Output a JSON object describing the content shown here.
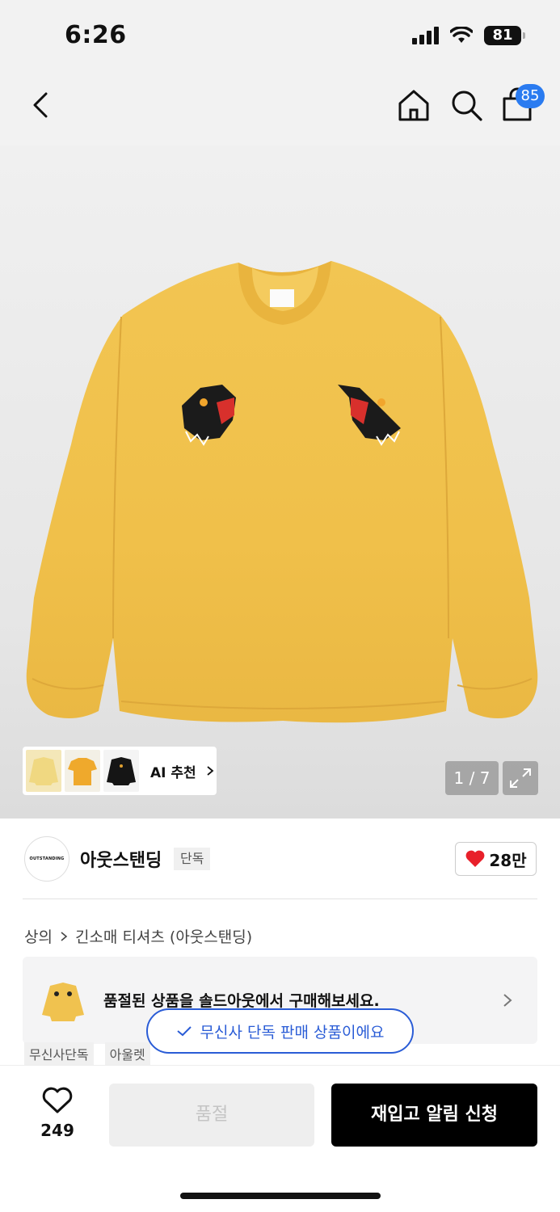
{
  "status_bar": {
    "time": "6:26",
    "battery": "81"
  },
  "nav": {
    "cart_badge": "85"
  },
  "gallery": {
    "ai_label": "AI 추천",
    "counter": "1 / 7",
    "thumbnails": [
      "yellow-sweatshirt",
      "yellow-tshirt",
      "black-sweatshirt"
    ]
  },
  "brand": {
    "logo_text": "OUTSTANDING",
    "name": "아웃스탠딩",
    "exclusive_tag": "단독",
    "like_count": "28만"
  },
  "breadcrumb": {
    "category": "상의",
    "subcategory": "긴소매 티셔츠 (아웃스탠딩)"
  },
  "soldout_banner": {
    "text": "품절된 상품을 솔드아웃에서 구매해보세요."
  },
  "tags": [
    "무신사단독",
    "아울렛"
  ],
  "toast": {
    "text": "무신사 단독 판매 상품이에요"
  },
  "bottom": {
    "wish_count": "249",
    "soldout_label": "품절",
    "restock_label": "재입고 알림 신청"
  },
  "colors": {
    "accent_blue": "#2a5cd6",
    "badge_blue": "#2a7bf0",
    "heart_red": "#e8202a",
    "product_yellow": "#f2c24e"
  }
}
